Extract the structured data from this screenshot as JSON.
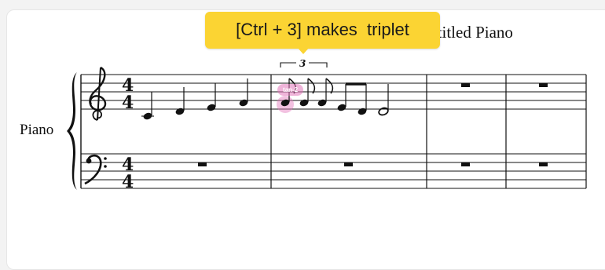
{
  "score": {
    "title": "Untitled Piano",
    "instrument": "Piano",
    "treble_time_signature": {
      "top": "4",
      "bottom": "4"
    },
    "bass_time_signature": {
      "top": "4",
      "bottom": "4"
    },
    "tuplet_number": "3"
  },
  "tooltip": {
    "text": "[Ctrl + 3] makes  triplet"
  },
  "cursor": {
    "label": "tan-2",
    "color": "#e276ba"
  },
  "colors": {
    "tooltip": "#fbd433",
    "ink": "#111111",
    "selection": "#e276ba"
  }
}
